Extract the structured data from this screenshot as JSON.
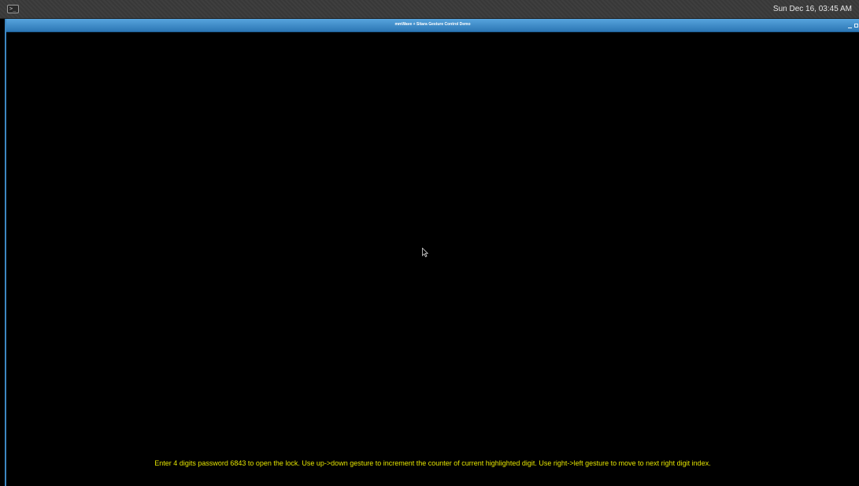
{
  "taskbar": {
    "terminal_icon": "terminal-icon",
    "clock": "Sun Dec 16, 03:45 AM"
  },
  "window": {
    "title": "mmWave + Sitara Gesture Control Demo",
    "controls": [
      "minimize-icon",
      "maximize-icon"
    ],
    "accent_color": "#3d87c2"
  },
  "app": {
    "instruction": "Enter 4 digits password 6843 to open the lock. Use up->down gesture to increment the counter of current highlighted digit. Use right->left gesture to move to next right digit index.",
    "instruction_color": "#e4e400",
    "background_color": "#000000"
  }
}
